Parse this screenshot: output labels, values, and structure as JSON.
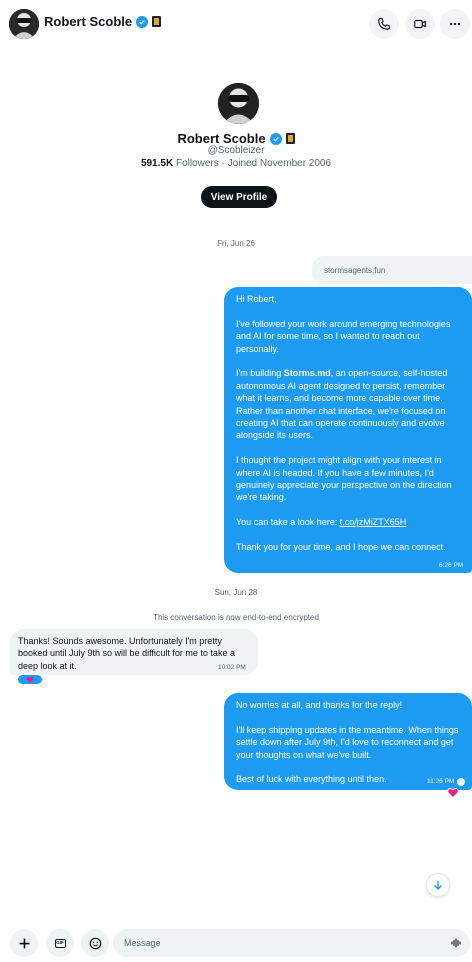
{
  "header": {
    "name": "Robert Scoble",
    "icons": [
      "phone-icon",
      "video-icon",
      "more-icon"
    ]
  },
  "profile": {
    "name": "Robert Scoble",
    "handle": "@Scobleizer",
    "followers": "591.5K",
    "followers_label": "Followers",
    "joined": "· Joined November 2006",
    "view_profile_label": "View Profile"
  },
  "dates": {
    "first": "Fri, Jun 26",
    "second": "Sun, Jun 28"
  },
  "messages": {
    "link_card": "stormsagents.fun",
    "out1": {
      "greeting": "Hi Robert,",
      "p1": "I've followed your work around emerging technologies and AI for some time, so I wanted to reach out personally.",
      "p2_pre": "I'm building ",
      "p2_bold": "Storms.md",
      "p2_post": ", an open-source, self-hosted autonomous AI agent designed to persist, remember what it learns, and become more capable over time. Rather than another chat interface, we're focused on creating AI that can operate continuously and evolve alongside its users.",
      "p3": "I thought the project might align with your interest in where AI is headed. If you have a few minutes, I'd genuinely appreciate your perspective on the direction we're taking.",
      "p4_pre": "You can take a look here: ",
      "p4_link": "t.co/jzMiZTX65H",
      "p5": "Thank you for your time, and I hope we can connect.",
      "time": "6:26 PM"
    },
    "encryption_note": "This conversation is now end-to-end encrypted",
    "in1": {
      "text": "Thanks! Sounds awesome. Unfortunately I'm pretty booked until July 9th so will be difficult for me to take a deep look at it.",
      "time": "10:02 PM"
    },
    "out2": {
      "p1": "No worries at all, and thanks for the reply!",
      "p2": "I'll keep shipping updates in the meantime. When things settle down after July 9th, I'd love to reconnect and get your thoughts on what we've built.",
      "p3": "Best of luck with everything until then.",
      "time": "11:26 PM"
    }
  },
  "composer": {
    "placeholder": "Message",
    "gif_label": "GIF"
  },
  "colors": {
    "accent": "#1d9bf0",
    "text": "#0f1419",
    "muted": "#536471",
    "surface": "#eff3f4"
  }
}
